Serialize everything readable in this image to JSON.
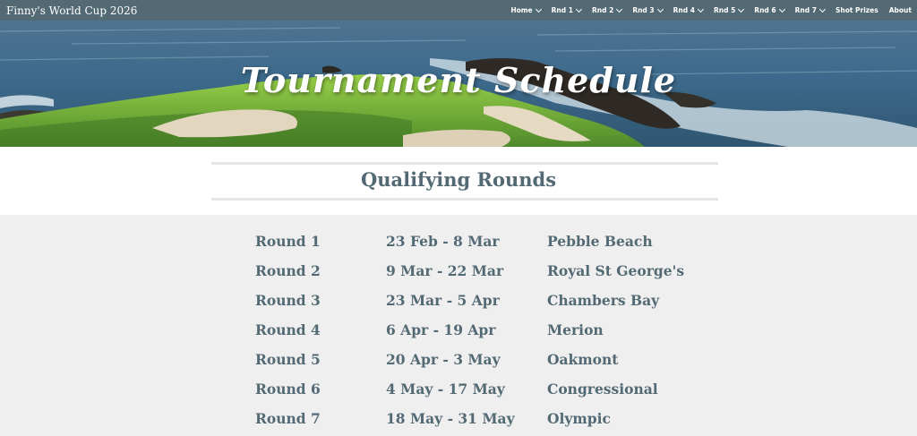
{
  "site": {
    "title": "Finny's World Cup 2026"
  },
  "nav": [
    {
      "label": "Home",
      "dropdown": true
    },
    {
      "label": "Rnd 1",
      "dropdown": true
    },
    {
      "label": "Rnd 2",
      "dropdown": true
    },
    {
      "label": "Rnd 3",
      "dropdown": true
    },
    {
      "label": "Rnd 4",
      "dropdown": true
    },
    {
      "label": "Rnd 5",
      "dropdown": true
    },
    {
      "label": "Rnd 6",
      "dropdown": true
    },
    {
      "label": "Rnd 7",
      "dropdown": true
    },
    {
      "label": "Shot Prizes",
      "dropdown": false
    },
    {
      "label": "About",
      "dropdown": false
    }
  ],
  "hero": {
    "title": "Tournament Schedule"
  },
  "section": {
    "title": "Qualifying Rounds"
  },
  "schedule": [
    {
      "round": "Round 1",
      "dates": "23 Feb - 8 Mar",
      "venue": "Pebble Beach"
    },
    {
      "round": "Round 2",
      "dates": "9 Mar - 22 Mar",
      "venue": "Royal St George's"
    },
    {
      "round": "Round 3",
      "dates": "23 Mar - 5 Apr",
      "venue": "Chambers Bay"
    },
    {
      "round": "Round 4",
      "dates": "6 Apr - 19 Apr",
      "venue": "Merion"
    },
    {
      "round": "Round 5",
      "dates": "20 Apr - 3 May",
      "venue": "Oakmont"
    },
    {
      "round": "Round 6",
      "dates": "4 May - 17 May",
      "venue": "Congressional"
    },
    {
      "round": "Round 7",
      "dates": "18 May - 31 May",
      "venue": "Olympic"
    }
  ],
  "colors": {
    "nav_bg": "#536a74",
    "text_accent": "#536a74",
    "page_bg": "#efefef"
  }
}
